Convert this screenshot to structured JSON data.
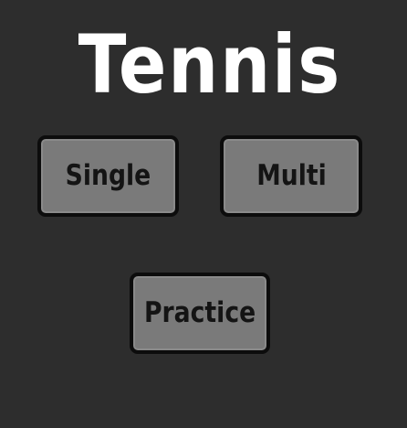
{
  "title": "Tennis",
  "buttons": {
    "single": "Single",
    "multi": "Multi",
    "practice": "Practice"
  },
  "colors": {
    "background": "#2d2d2d",
    "title": "#ffffff",
    "button_fill": "#7a7a7a",
    "button_border": "#0c0c0c",
    "button_text": "#141414"
  }
}
